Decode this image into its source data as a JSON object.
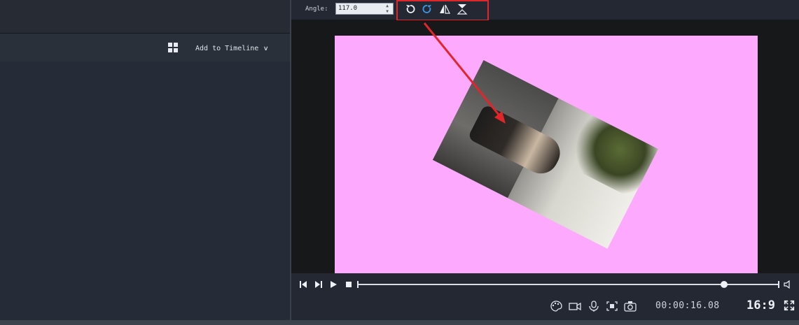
{
  "left_panel": {
    "add_to_timeline_label": "Add to Timeline"
  },
  "toolbar": {
    "angle_label": "Angle:",
    "angle_value": "117.0",
    "tools": [
      "rotate-left-icon",
      "rotate-right-icon",
      "flip-horizontal-icon",
      "flip-vertical-icon"
    ]
  },
  "player": {
    "timecode": "00:00:16.08",
    "aspect_ratio": "16:9",
    "playhead_fraction": 0.87,
    "buttons": [
      "previous-frame-icon",
      "next-frame-icon",
      "play-icon",
      "stop-icon",
      "volume-icon"
    ],
    "bottom_icons": [
      "color-palette-icon",
      "camera-record-icon",
      "microphone-icon",
      "screen-capture-icon",
      "snapshot-icon",
      "fullscreen-icon"
    ]
  },
  "colors": {
    "canvas_background": "#fda9fe",
    "highlight": "#e1262b",
    "active_tool": "#3b9ae8"
  }
}
